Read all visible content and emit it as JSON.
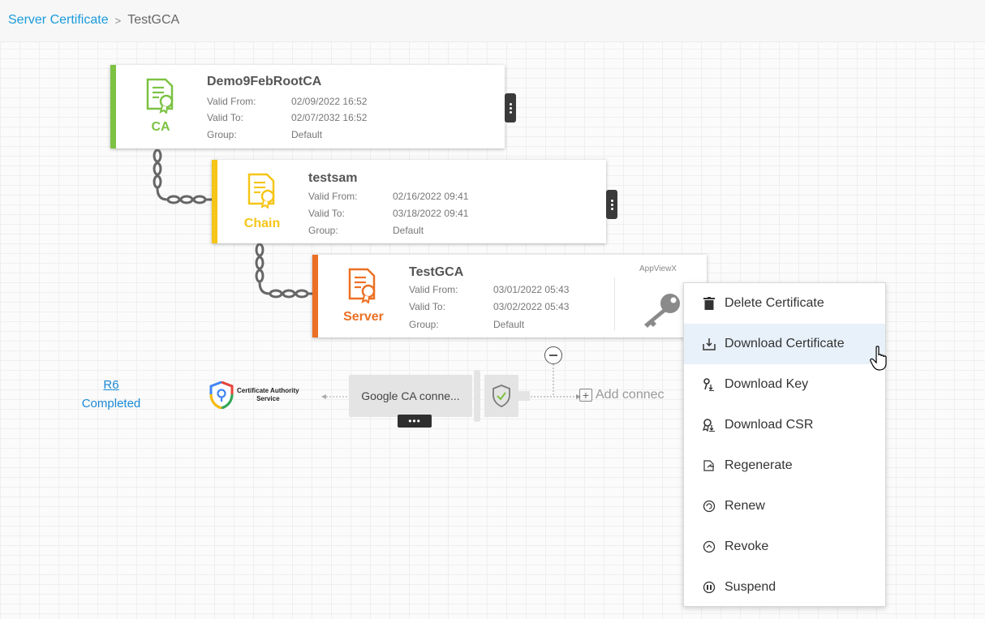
{
  "breadcrumb": {
    "parent": "Server Certificate",
    "separator": ">",
    "current": "TestGCA"
  },
  "cards": [
    {
      "type_label": "CA",
      "name": "Demo9FebRootCA",
      "valid_from_label": "Valid From:",
      "valid_from": "02/09/2022 16:52",
      "valid_to_label": "Valid To:",
      "valid_to": "02/07/2032 16:52",
      "group_label": "Group:",
      "group": "Default",
      "color": "#7cc243"
    },
    {
      "type_label": "Chain",
      "name": "testsam",
      "valid_from_label": "Valid From:",
      "valid_from": "02/16/2022 09:41",
      "valid_to_label": "Valid To:",
      "valid_to": "03/18/2022 09:41",
      "group_label": "Group:",
      "group": "Default",
      "color": "#f5c518"
    },
    {
      "type_label": "Server",
      "name": "TestGCA",
      "valid_from_label": "Valid From:",
      "valid_from": "03/01/2022 05:43",
      "valid_to_label": "Valid To:",
      "valid_to": "03/02/2022 05:43",
      "group_label": "Group:",
      "group": "Default",
      "color": "#ec7024",
      "vendor": "AppViewX"
    }
  ],
  "workflow": {
    "request_id": "R6",
    "status": "Completed",
    "ca_logo_line1": "Certificate Authority",
    "ca_logo_line2": "Service",
    "connector_label": "Google CA conne...",
    "more_label": "•••",
    "add_connector_label": "Add connec"
  },
  "context_menu": {
    "items": [
      {
        "label": "Delete Certificate",
        "icon": "trash-icon"
      },
      {
        "label": "Download Certificate",
        "icon": "download-icon"
      },
      {
        "label": "Download Key",
        "icon": "key-download-icon"
      },
      {
        "label": "Download CSR",
        "icon": "csr-download-icon"
      },
      {
        "label": "Regenerate",
        "icon": "regenerate-icon"
      },
      {
        "label": "Renew",
        "icon": "renew-icon"
      },
      {
        "label": "Revoke",
        "icon": "revoke-icon"
      },
      {
        "label": "Suspend",
        "icon": "suspend-icon"
      }
    ],
    "hovered_item": "Download Certificate"
  },
  "colors": {
    "link": "#1a9bdb",
    "ca": "#7cc243",
    "chain": "#f5c518",
    "server": "#ec7024",
    "menu_hover": "#e8f1fa"
  }
}
